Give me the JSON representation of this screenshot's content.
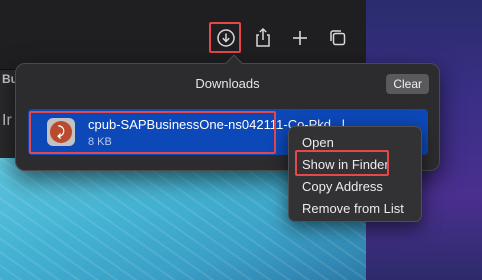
{
  "downloads": {
    "title": "Downloads",
    "clear_label": "Clear",
    "item": {
      "file_name": "cpub-SAPBusinessOne-ns042111-Co-Pkd...l",
      "file_size": "8 KB"
    }
  },
  "page": {
    "cut_label_top": "Bu",
    "cut_label_side": "Ir"
  },
  "context_menu": {
    "items": [
      "Open",
      "Show in Finder",
      "Copy Address",
      "Remove from List"
    ]
  },
  "colors": {
    "selection": "#0d48b8",
    "highlight_box": "#e54848"
  }
}
